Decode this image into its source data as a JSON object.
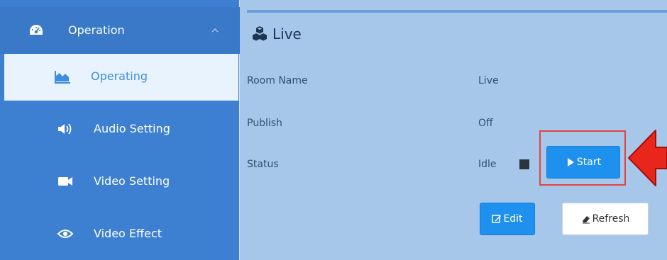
{
  "sidebar": {
    "group": {
      "label": "Operation",
      "icon": "dashboard-icon"
    },
    "items": [
      {
        "label": "Operating",
        "icon": "area-chart-icon",
        "active": true
      },
      {
        "label": "Audio Setting",
        "icon": "volume-icon",
        "active": false
      },
      {
        "label": "Video Setting",
        "icon": "video-camera-icon",
        "active": false
      },
      {
        "label": "Video Effect",
        "icon": "eye-effect-icon",
        "active": false
      }
    ]
  },
  "panel": {
    "title": "Live",
    "title_icon": "cubes-icon",
    "fields": [
      {
        "label": "Room Name",
        "value": "Live"
      },
      {
        "label": "Publish",
        "value": "Off"
      },
      {
        "label": "Status",
        "value": "Idle"
      }
    ],
    "buttons": {
      "start": "Start",
      "edit": "Edit",
      "refresh": "Refresh"
    }
  },
  "colors": {
    "sidebar_bg": "#3d7fd0",
    "sidebar_active_bg": "#e8f3fd",
    "main_bg": "#a6c6ea",
    "button_primary": "#1e90ee",
    "highlight": "#e2453f"
  }
}
